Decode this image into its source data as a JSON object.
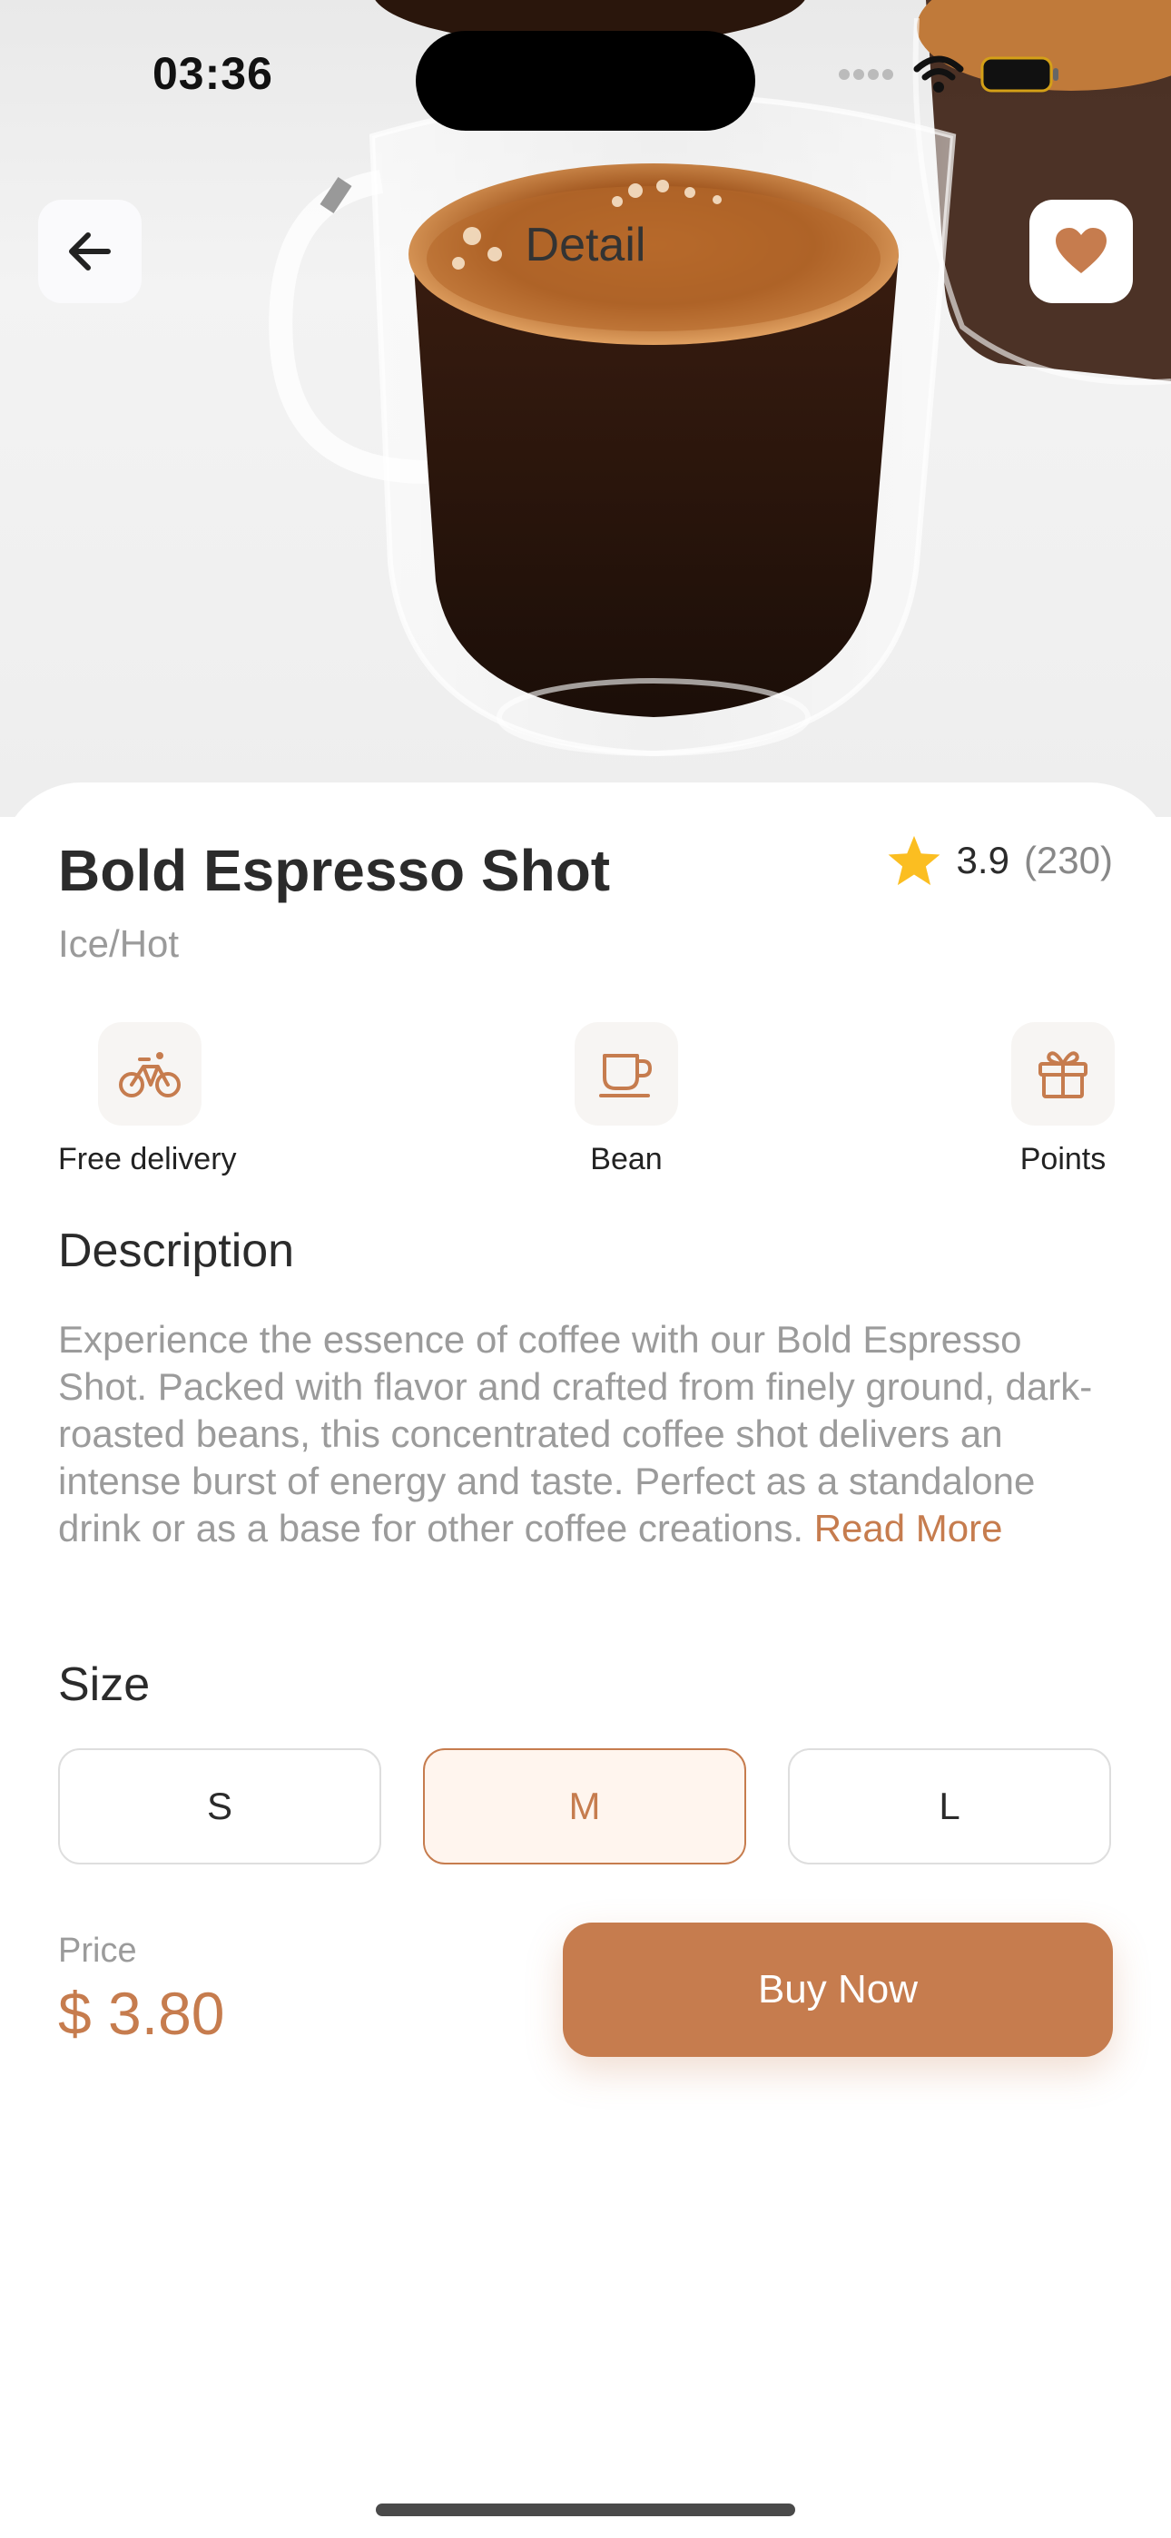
{
  "status_bar": {
    "time": "03:36"
  },
  "nav": {
    "title": "Detail",
    "back_icon": "arrow-left-icon",
    "favorite_icon": "heart-icon"
  },
  "hero": {
    "image_description": "Espresso in double-wall glass cups"
  },
  "product": {
    "name": "Bold Espresso Shot",
    "subtitle": "Ice/Hot",
    "rating": "3.9",
    "reviews": "(230)"
  },
  "features": [
    {
      "label": "Free delivery",
      "icon": "bicycle-icon"
    },
    {
      "label": "Bean",
      "icon": "coffee-cup-icon"
    },
    {
      "label": "Points",
      "icon": "gift-icon"
    }
  ],
  "description": {
    "heading": "Description",
    "text": "Experience the essence of coffee with our Bold Espresso Shot. Packed with flavor and crafted from finely ground, dark-roasted beans, this concentrated coffee shot delivers an intense burst of energy and taste. Perfect as a standalone drink or as a base for other coffee creations.",
    "read_more": "Read More"
  },
  "size": {
    "heading": "Size",
    "options": [
      "S",
      "M",
      "L"
    ],
    "selected": "M"
  },
  "price": {
    "label": "Price",
    "value": "$ 3.80"
  },
  "buy_button": "Buy Now",
  "colors": {
    "accent": "#c67c4e",
    "accent_light": "#fff5ee",
    "text": "#2b2b2b",
    "muted": "#9b9b9b"
  }
}
